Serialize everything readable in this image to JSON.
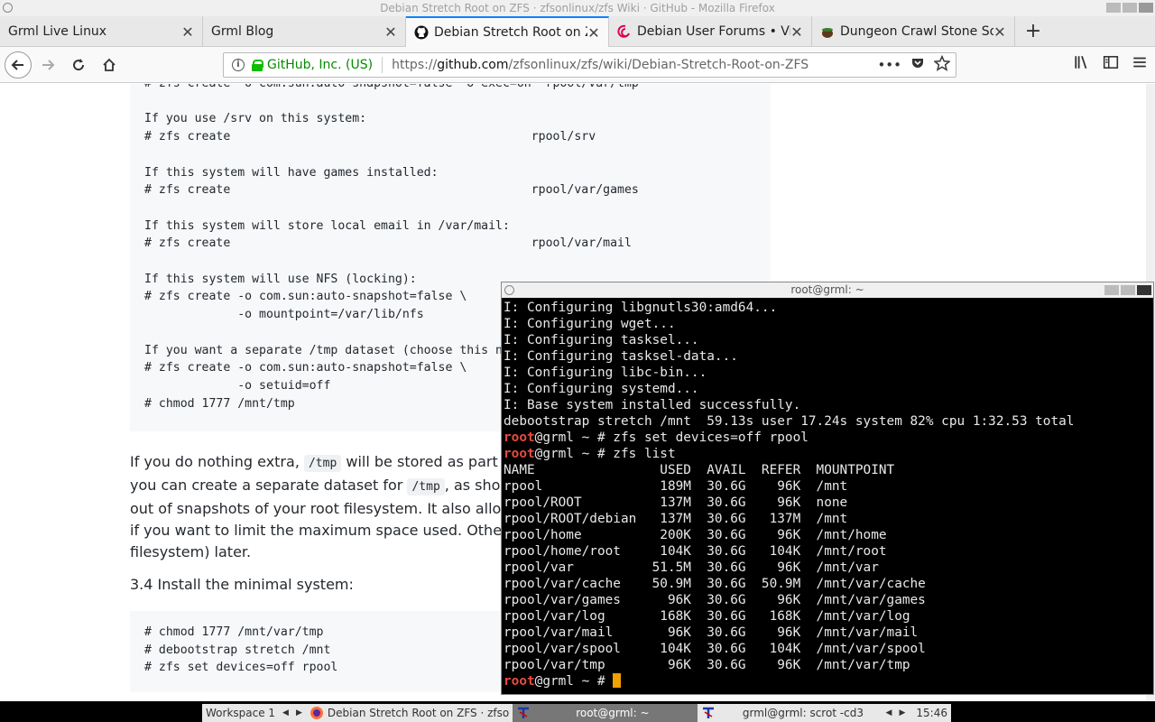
{
  "window": {
    "title": "Debian Stretch Root on ZFS · zfsonlinux/zfs Wiki · GitHub - Mozilla Firefox"
  },
  "tabs": [
    {
      "label": "Grml Live Linux",
      "active": false
    },
    {
      "label": "Grml Blog",
      "active": false
    },
    {
      "label": "Debian Stretch Root on ZFS",
      "active": true
    },
    {
      "label": "Debian User Forums • View",
      "active": false
    },
    {
      "label": "Dungeon Crawl Stone Soup",
      "active": false
    }
  ],
  "newtab_label": "+",
  "navbar": {
    "identity": "GitHub, Inc. (US)",
    "url_prefix": "https://",
    "url_domain": "github.com",
    "url_path": "/zfsonlinux/zfs/wiki/Debian-Stretch-Root-on-ZFS",
    "more_label": "•••"
  },
  "page": {
    "code1": "# zfs create -o com.sun:auto-snapshot=false -o exec=on  rpool/var/tmp\n\nIf you use /srv on this system:\n# zfs create                                          rpool/srv\n\nIf this system will have games installed:\n# zfs create                                          rpool/var/games\n\nIf this system will store local email in /var/mail:\n# zfs create                                          rpool/var/mail\n\nIf this system will use NFS (locking):\n# zfs create -o com.sun:auto-snapshot=false \\\n             -o mountpoint=/var/lib/nfs\n\nIf you want a separate /tmp dataset (choose this now or tmpfs later):\n# zfs create -o com.sun:auto-snapshot=false \\\n             -o setuid=off\n# chmod 1777 /mnt/tmp",
    "para1_a": "If you do nothing extra, ",
    "para1_code1": "/tmp",
    "para1_b": " will be stored as part of the root filesystem. Alternatively,",
    "para1_c": "you can create a separate dataset for ",
    "para1_code2": "/tmp",
    "para1_d": ", as shown above. This keeps the /tmp data",
    "para1_e": "out of snapshots of your root filesystem. It also allows you to set a quota on rpool/tmp,",
    "para1_f": "if you want to limit the maximum space used. Otherwise, you can use a tmpfs (RAM",
    "para1_g": "filesystem) later.",
    "para2": "3.4 Install the minimal system:",
    "code2": "# chmod 1777 /mnt/var/tmp\n# debootstrap stretch /mnt\n# zfs set devices=off rpool"
  },
  "terminal": {
    "title": "root@grml: ~",
    "lines_before": "I: Configuring libgnutls30:amd64...\nI: Configuring wget...\nI: Configuring tasksel...\nI: Configuring tasksel-data...\nI: Configuring libc-bin...\nI: Configuring systemd...\nI: Base system installed successfully.\ndebootstrap stretch /mnt  59.13s user 17.24s system 82% cpu 1:32.53 total",
    "prompt_user": "root",
    "prompt_rest": "@grml ~ # ",
    "cmd1": "zfs set devices=off rpool",
    "cmd2": "zfs list",
    "list_output": "NAME                USED  AVAIL  REFER  MOUNTPOINT\nrpool               189M  30.6G    96K  /mnt\nrpool/ROOT          137M  30.6G    96K  none\nrpool/ROOT/debian   137M  30.6G   137M  /mnt\nrpool/home          200K  30.6G    96K  /mnt/home\nrpool/home/root     104K  30.6G   104K  /mnt/root\nrpool/var          51.5M  30.6G    96K  /mnt/var\nrpool/var/cache    50.9M  30.6G  50.9M  /mnt/var/cache\nrpool/var/games      96K  30.6G    96K  /mnt/var/games\nrpool/var/log       168K  30.6G   168K  /mnt/var/log\nrpool/var/mail       96K  30.6G    96K  /mnt/var/mail\nrpool/var/spool     104K  30.6G   104K  /mnt/var/spool\nrpool/var/tmp        96K  30.6G    96K  /mnt/var/tmp"
  },
  "taskbar": {
    "workspace": "Workspace 1",
    "item1": "Debian Stretch Root on ZFS · zfso",
    "item2": "root@grml: ~",
    "item3": "grml@grml: scrot -cd3",
    "clock": "15:46"
  }
}
